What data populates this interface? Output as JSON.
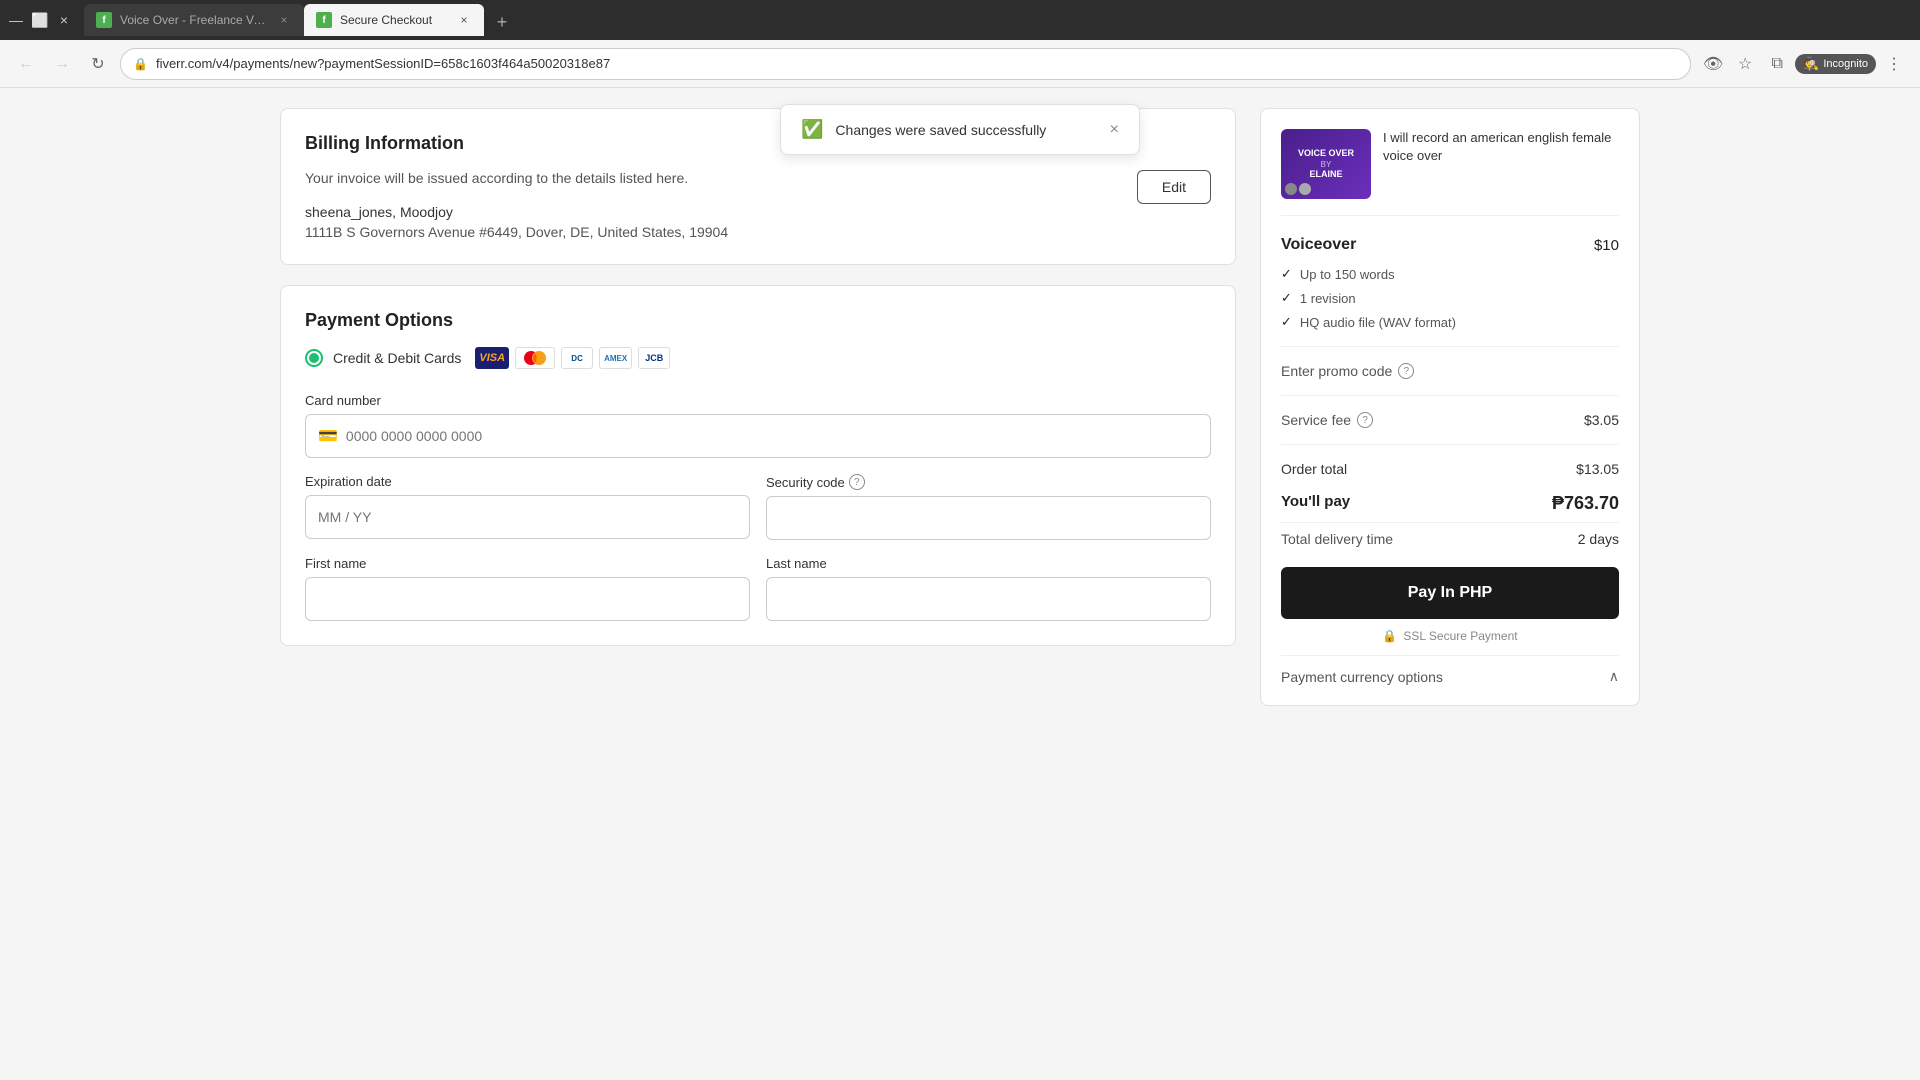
{
  "browser": {
    "tabs": [
      {
        "id": "tab1",
        "title": "Voice Over - Freelance Voice A...",
        "favicon_color": "#4CAF50",
        "active": false
      },
      {
        "id": "tab2",
        "title": "Secure Checkout",
        "favicon_color": "#4CAF50",
        "active": true
      }
    ],
    "url": "fiverr.com/v4/payments/new?paymentSessionID=658c1603f464a50020318e87",
    "incognito_label": "Incognito"
  },
  "toast": {
    "message": "Changes were saved successfully",
    "close_label": "×"
  },
  "billing": {
    "section_title": "Billing Information",
    "description": "Your invoice will be issued according to the details listed here.",
    "edit_button_label": "Edit",
    "name": "sheena_jones, Moodjoy",
    "address": "1111B S Governors Avenue #6449, Dover, DE, United States, 19904"
  },
  "payment": {
    "section_title": "Payment Options",
    "credit_card_label": "Credit & Debit Cards",
    "card_icons": [
      "VISA",
      "MC",
      "Diners",
      "AMEX",
      "JCB"
    ],
    "card_number_label": "Card number",
    "card_number_placeholder": "0000 0000 0000 0000",
    "expiry_label": "Expiration date",
    "expiry_placeholder": "MM / YY",
    "security_label": "Security code",
    "security_help": "?",
    "first_name_label": "First name",
    "last_name_label": "Last name"
  },
  "order_summary": {
    "gig_thumb_top": "VOICE OVER",
    "gig_thumb_by": "BY",
    "gig_thumb_name": "ELAINE",
    "gig_title": "I will record an american english female voice over",
    "service_name": "Voiceover",
    "service_price": "$10",
    "features": [
      "Up to 150 words",
      "1 revision",
      "HQ audio file (WAV format)"
    ],
    "promo_label": "Enter promo code",
    "service_fee_label": "Service fee",
    "service_fee_value": "$3.05",
    "order_total_label": "Order total",
    "order_total_value": "$13.05",
    "you_pay_label": "You'll pay",
    "you_pay_value": "₱763.70",
    "delivery_label": "Total delivery time",
    "delivery_value": "2 days",
    "pay_button_label": "Pay In PHP",
    "ssl_label": "SSL Secure Payment",
    "currency_options_label": "Payment currency options"
  },
  "icons": {
    "back": "←",
    "forward": "→",
    "refresh": "↻",
    "lock": "🔒",
    "star": "☆",
    "extensions": "⧉",
    "menu": "⋮",
    "check": "✓",
    "info": "?",
    "shield": "🔒",
    "lock_small": "🔒",
    "chevron_up": "∧",
    "close": "×"
  }
}
